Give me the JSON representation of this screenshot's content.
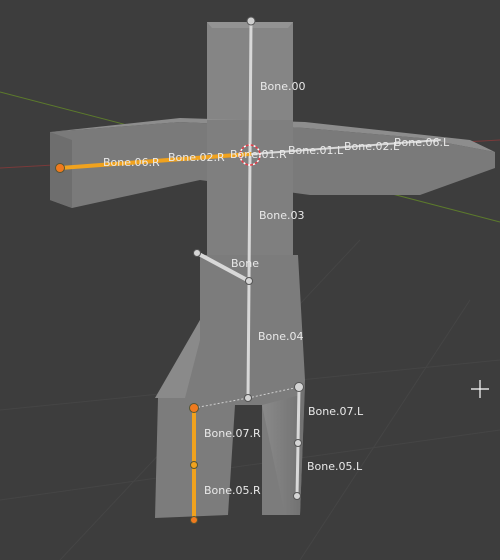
{
  "viewport": {
    "name": "3D Viewport",
    "background": "#3d3d3d",
    "axis_x_color": "#7a3a3a",
    "axis_y_color": "#5c7a2c",
    "mesh_color": "#7d7d7d",
    "bone_color": "#d8d8d8",
    "selected_bone_color": "#f0a21e",
    "cursor_icon": "3d-cursor-icon"
  },
  "bones": {
    "bone_00": "Bone.00",
    "bone_01_r": "Bone.01.R",
    "bone_01_l": "Bone.01.L",
    "bone_02_r": "Bone.02.R",
    "bone_02_l": "Bone.02.L",
    "bone_06_r": "Bone.06.R",
    "bone_06_l": "Bone.06.L",
    "bone_03": "Bone.03",
    "bone": "Bone",
    "bone_04": "Bone.04",
    "bone_07_r": "Bone.07.R",
    "bone_07_l": "Bone.07.L",
    "bone_05_r": "Bone.05.R",
    "bone_05_l": "Bone.05.L"
  },
  "selection": {
    "selected_bones": [
      "Bone.06.R",
      "Bone.02.R",
      "Bone.07.R",
      "Bone.05.R"
    ]
  }
}
